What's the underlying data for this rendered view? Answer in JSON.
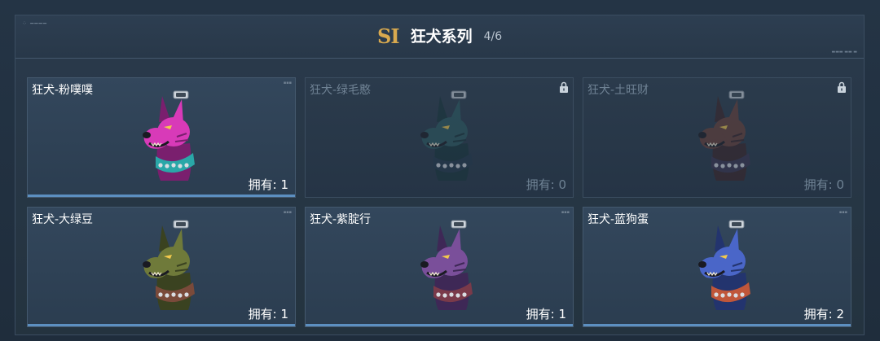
{
  "header": {
    "badge": "SI",
    "title": "狂犬系列",
    "count": "4/6"
  },
  "colors": {
    "accent_gold": "#d8a94f",
    "selected_bar": "#d66ad8",
    "owned_bar": "#5c8fc0"
  },
  "cards": [
    {
      "name": "狂犬-粉噗噗",
      "owned": "拥有: 1",
      "locked": false,
      "selected": true,
      "icon": "pink-dog-pendant-icon"
    },
    {
      "name": "狂犬-绿毛憨",
      "owned": "拥有: 0",
      "locked": true,
      "selected": false,
      "icon": "teal-dog-pendant-icon"
    },
    {
      "name": "狂犬-土旺财",
      "owned": "拥有: 0",
      "locked": true,
      "selected": false,
      "icon": "brown-dog-pendant-icon"
    },
    {
      "name": "狂犬-大绿豆",
      "owned": "拥有: 1",
      "locked": false,
      "selected": false,
      "icon": "green-dog-pendant-icon"
    },
    {
      "name": "狂犬-紫腚行",
      "owned": "拥有: 1",
      "locked": false,
      "selected": false,
      "icon": "purple-dog-pendant-icon"
    },
    {
      "name": "狂犬-蓝狗蛋",
      "owned": "拥有: 2",
      "locked": false,
      "selected": false,
      "icon": "blue-dog-pendant-icon"
    }
  ]
}
